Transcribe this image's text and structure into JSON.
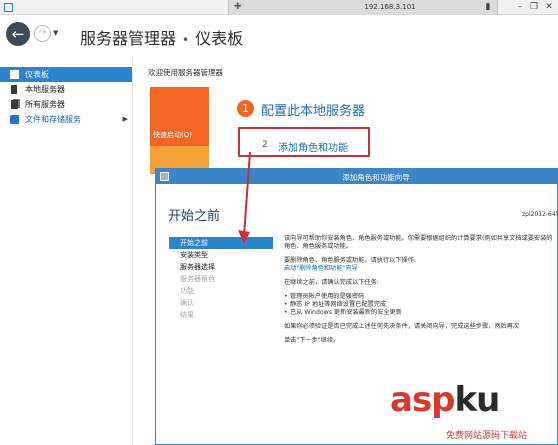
{
  "remote": {
    "ip": "192.168.3.101"
  },
  "header": {
    "title_main": "服务器管理器",
    "title_sep": "•",
    "title_page": "仪表板"
  },
  "sidebar": {
    "items": [
      {
        "label": "仪表板",
        "icon": "dashboard-icon",
        "active": true
      },
      {
        "label": "本地服务器",
        "icon": "server-icon",
        "active": false
      },
      {
        "label": "所有服务器",
        "icon": "servers-icon",
        "active": false
      },
      {
        "label": "文件和存储服务",
        "icon": "storage-icon",
        "active": false
      }
    ]
  },
  "main": {
    "welcome": "欢迎使用服务器管理器",
    "quick_start": "快速启动(Q)",
    "step1_num": "1",
    "step1_label": "配置此本地服务器",
    "step2_num": "2",
    "step2_label": "添加角色和功能"
  },
  "wizard": {
    "title": "添加角色和功能向导",
    "heading": "开始之前",
    "server": "zpl2012-645",
    "steps": [
      {
        "label": "开始之前",
        "state": "active"
      },
      {
        "label": "安装类型",
        "state": "normal"
      },
      {
        "label": "服务器选择",
        "state": "normal"
      },
      {
        "label": "服务器角色",
        "state": "disabled"
      },
      {
        "label": "功能",
        "state": "disabled"
      },
      {
        "label": "确认",
        "state": "disabled"
      },
      {
        "label": "结果",
        "state": "disabled"
      }
    ],
    "body": {
      "p1": "该向导可帮助你安装角色、角色服务或功能。你需要根据组织的计算要求(例如共享文档或要安装的角色、角色服务或功能。",
      "p2": "要删除角色、角色服务或功能，请执行以下操作:",
      "p2_link": "启动\"删除角色和功能\"向导",
      "p3": "在继续之前，请确认完成以下任务:",
      "bullets": [
        "管理员帐户使用的是强密码",
        "静态 IP 地址等网络设置已配置完成",
        "已从 Windows 更新安装最新的安全更新"
      ],
      "p4": "如果你必须验证是否已完成上述任何先决条件，请关闭向导，完成这些步骤，然后再次",
      "p5": "单击\"下一步\"继续。"
    }
  },
  "watermark": {
    "asp": "asp",
    "ku": "ku",
    "sub": "免费网站源码下载站"
  },
  "colors": {
    "accent": "#2c84cd",
    "orange": "#f26522",
    "highlight": "#c8323c",
    "link": "#1b6ac9"
  }
}
